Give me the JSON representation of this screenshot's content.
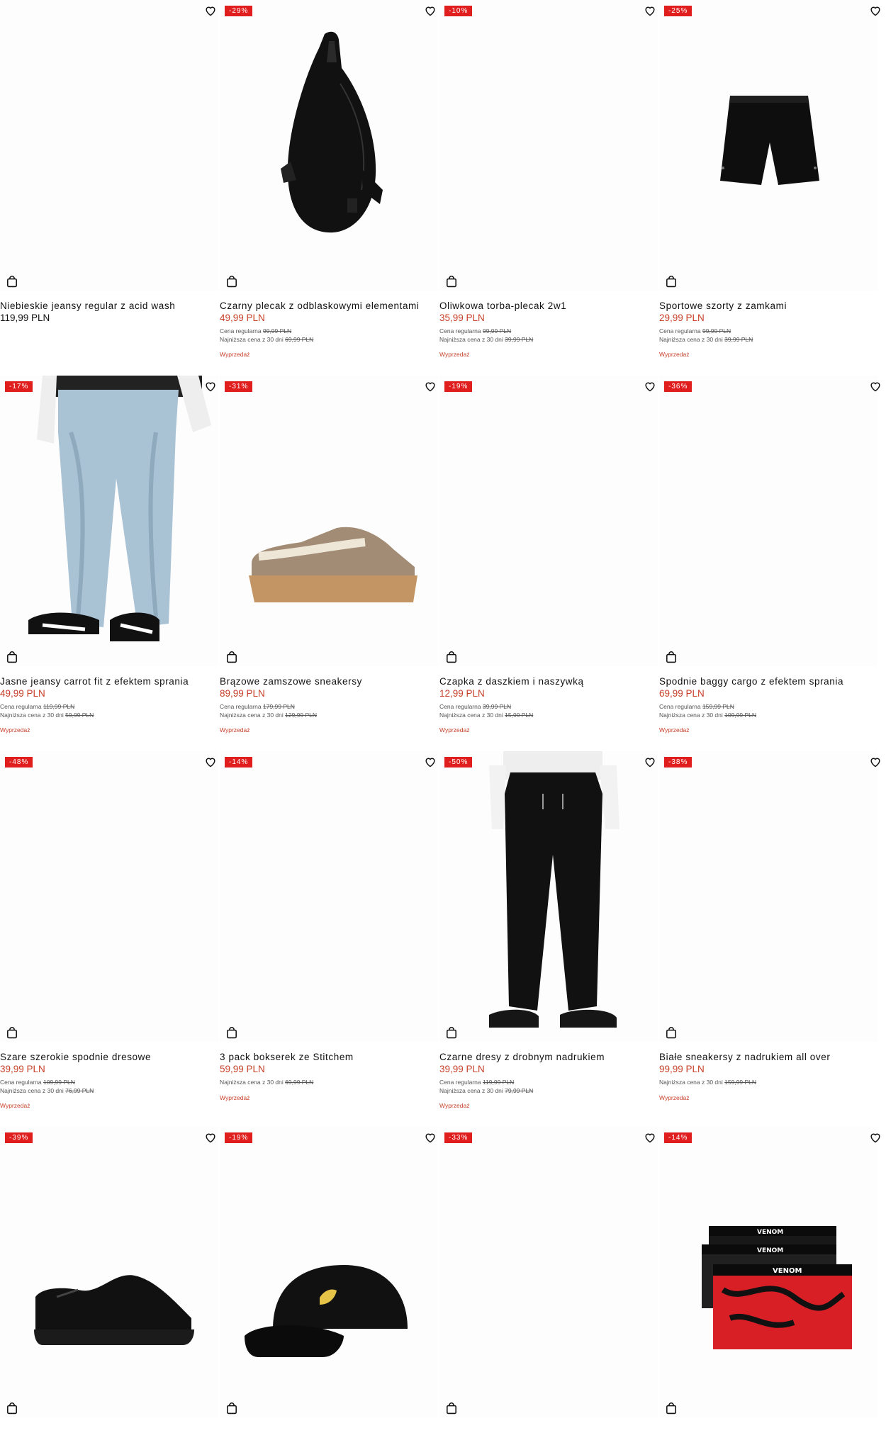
{
  "products": [
    {
      "badge": "",
      "title": "Niebieskie jeansy regular z acid wash",
      "price": "119,99 PLN",
      "regular_label": "",
      "regular_price": "",
      "lowest_label": "",
      "lowest_price": "",
      "promo": ""
    },
    {
      "badge": "-29%",
      "title": "Czarny plecak z odblaskowymi elementami",
      "price": "49,99 PLN",
      "regular_label": "Cena regularna",
      "regular_price": "99,99 PLN",
      "lowest_label": "Najniższa cena z 30 dni",
      "lowest_price": "69,99 PLN",
      "promo": "Wyprzedaż"
    },
    {
      "badge": "-10%",
      "title": "Oliwkowa torba-plecak 2w1",
      "price": "35,99 PLN",
      "regular_label": "Cena regularna",
      "regular_price": "99,99 PLN",
      "lowest_label": "Najniższa cena z 30 dni",
      "lowest_price": "39,99 PLN",
      "promo": "Wyprzedaż"
    },
    {
      "badge": "-25%",
      "title": "Sportowe szorty z zamkami",
      "price": "29,99 PLN",
      "regular_label": "Cena regularna",
      "regular_price": "99,99 PLN",
      "lowest_label": "Najniższa cena z 30 dni",
      "lowest_price": "39,99 PLN",
      "promo": "Wyprzedaż"
    },
    {
      "badge": "-17%",
      "title": "Jasne jeansy carrot fit z efektem sprania",
      "price": "49,99 PLN",
      "regular_label": "Cena regularna",
      "regular_price": "119,99 PLN",
      "lowest_label": "Najniższa cena z 30 dni",
      "lowest_price": "59,99 PLN",
      "promo": "Wyprzedaż"
    },
    {
      "badge": "-31%",
      "title": "Brązowe zamszowe sneakersy",
      "price": "89,99 PLN",
      "regular_label": "Cena regularna",
      "regular_price": "179,99 PLN",
      "lowest_label": "Najniższa cena z 30 dni",
      "lowest_price": "129,99 PLN",
      "promo": "Wyprzedaż"
    },
    {
      "badge": "-19%",
      "title": "Czapka z daszkiem i naszywką",
      "price": "12,99 PLN",
      "regular_label": "Cena regularna",
      "regular_price": "39,99 PLN",
      "lowest_label": "Najniższa cena z 30 dni",
      "lowest_price": "15,99 PLN",
      "promo": "Wyprzedaż"
    },
    {
      "badge": "-36%",
      "title": "Spodnie baggy cargo z efektem sprania",
      "price": "69,99 PLN",
      "regular_label": "Cena regularna",
      "regular_price": "159,99 PLN",
      "lowest_label": "Najniższa cena z 30 dni",
      "lowest_price": "109,99 PLN",
      "promo": "Wyprzedaż"
    },
    {
      "badge": "-48%",
      "title": "Szare szerokie spodnie dresowe",
      "price": "39,99 PLN",
      "regular_label": "Cena regularna",
      "regular_price": "109,99 PLN",
      "lowest_label": "Najniższa cena z 30 dni",
      "lowest_price": "76,99 PLN",
      "promo": "Wyprzedaż"
    },
    {
      "badge": "-14%",
      "title": "3 pack bokserek ze Stitchem",
      "price": "59,99 PLN",
      "regular_label": "",
      "regular_price": "",
      "lowest_label": "Najniższa cena z 30 dni",
      "lowest_price": "69,99 PLN",
      "promo": "Wyprzedaż"
    },
    {
      "badge": "-50%",
      "title": "Czarne dresy z drobnym nadrukiem",
      "price": "39,99 PLN",
      "regular_label": "Cena regularna",
      "regular_price": "119,99 PLN",
      "lowest_label": "Najniższa cena z 30 dni",
      "lowest_price": "79,99 PLN",
      "promo": "Wyprzedaż"
    },
    {
      "badge": "-38%",
      "title": "Białe sneakersy z nadrukiem all over",
      "price": "99,99 PLN",
      "regular_label": "",
      "regular_price": "",
      "lowest_label": "Najniższa cena z 30 dni",
      "lowest_price": "159,99 PLN",
      "promo": "Wyprzedaż"
    },
    {
      "badge": "-39%",
      "title": "",
      "price": "",
      "regular_label": "",
      "regular_price": "",
      "lowest_label": "",
      "lowest_price": "",
      "promo": ""
    },
    {
      "badge": "-19%",
      "title": "",
      "price": "",
      "regular_label": "",
      "regular_price": "",
      "lowest_label": "",
      "lowest_price": "",
      "promo": ""
    },
    {
      "badge": "-33%",
      "title": "",
      "price": "",
      "regular_label": "",
      "regular_price": "",
      "lowest_label": "",
      "lowest_price": "",
      "promo": ""
    },
    {
      "badge": "-14%",
      "title": "",
      "price": "",
      "regular_label": "",
      "regular_price": "",
      "lowest_label": "",
      "lowest_price": "",
      "promo": ""
    }
  ],
  "image_text": {
    "boxer_brand": "VENOM"
  },
  "colors": {
    "badge": "#e01e1e",
    "sale_price": "#c8402a",
    "text": "#111111"
  },
  "icons": {
    "wishlist": "heart-icon",
    "cart": "shopping-bag-icon"
  }
}
